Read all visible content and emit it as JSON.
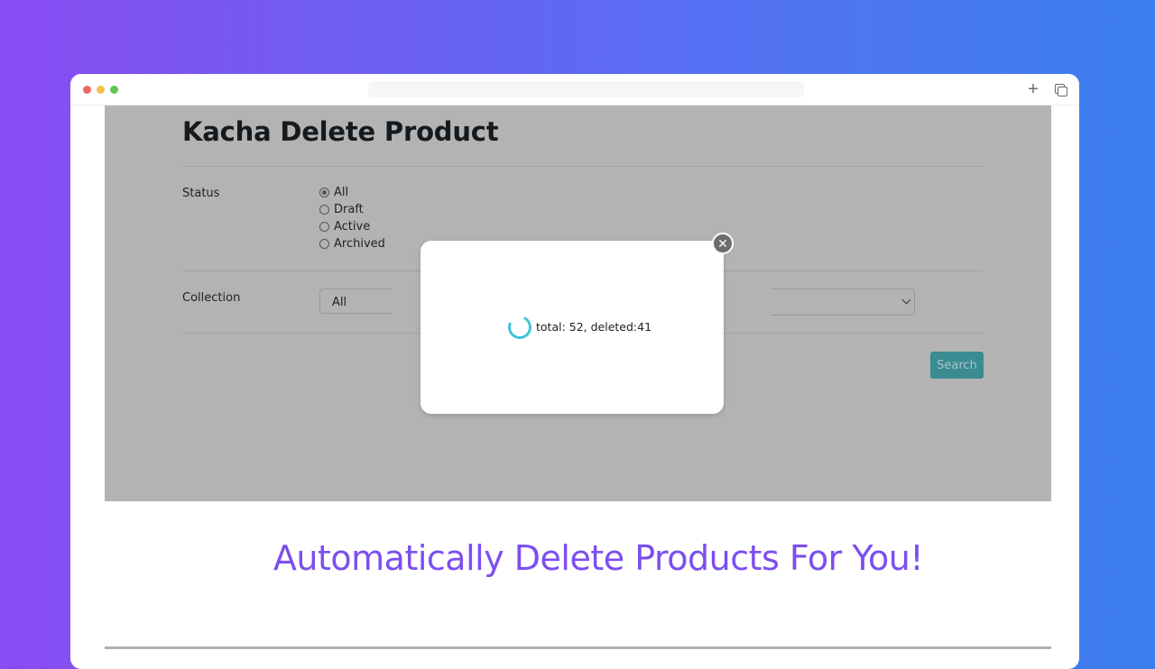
{
  "browser": {
    "window_controls": [
      "close",
      "minimize",
      "maximize"
    ],
    "address_bar_value": "",
    "icons": {
      "new_tab": "plus-icon",
      "tabs": "tabs-icon"
    }
  },
  "app": {
    "title": "Kacha Delete Product",
    "status": {
      "label": "Status",
      "options": [
        {
          "label": "All",
          "checked": true
        },
        {
          "label": "Draft",
          "checked": false
        },
        {
          "label": "Active",
          "checked": false
        },
        {
          "label": "Archived",
          "checked": false
        }
      ]
    },
    "collection": {
      "label": "Collection",
      "selected": "All"
    },
    "search_button": "Search"
  },
  "modal": {
    "progress_text": "total: 52, deleted:41",
    "total": 52,
    "deleted": 41,
    "spinner_color": "#42c2dc",
    "close_icon": "close-icon"
  },
  "tagline": "Automatically Delete Products For You!",
  "colors": {
    "tagline": "#7c4ef0",
    "search_button": "#3a8b92",
    "overlay": "#b3b3b3",
    "gradient_start": "#8a4cf3",
    "gradient_end": "#3b7ef0"
  }
}
